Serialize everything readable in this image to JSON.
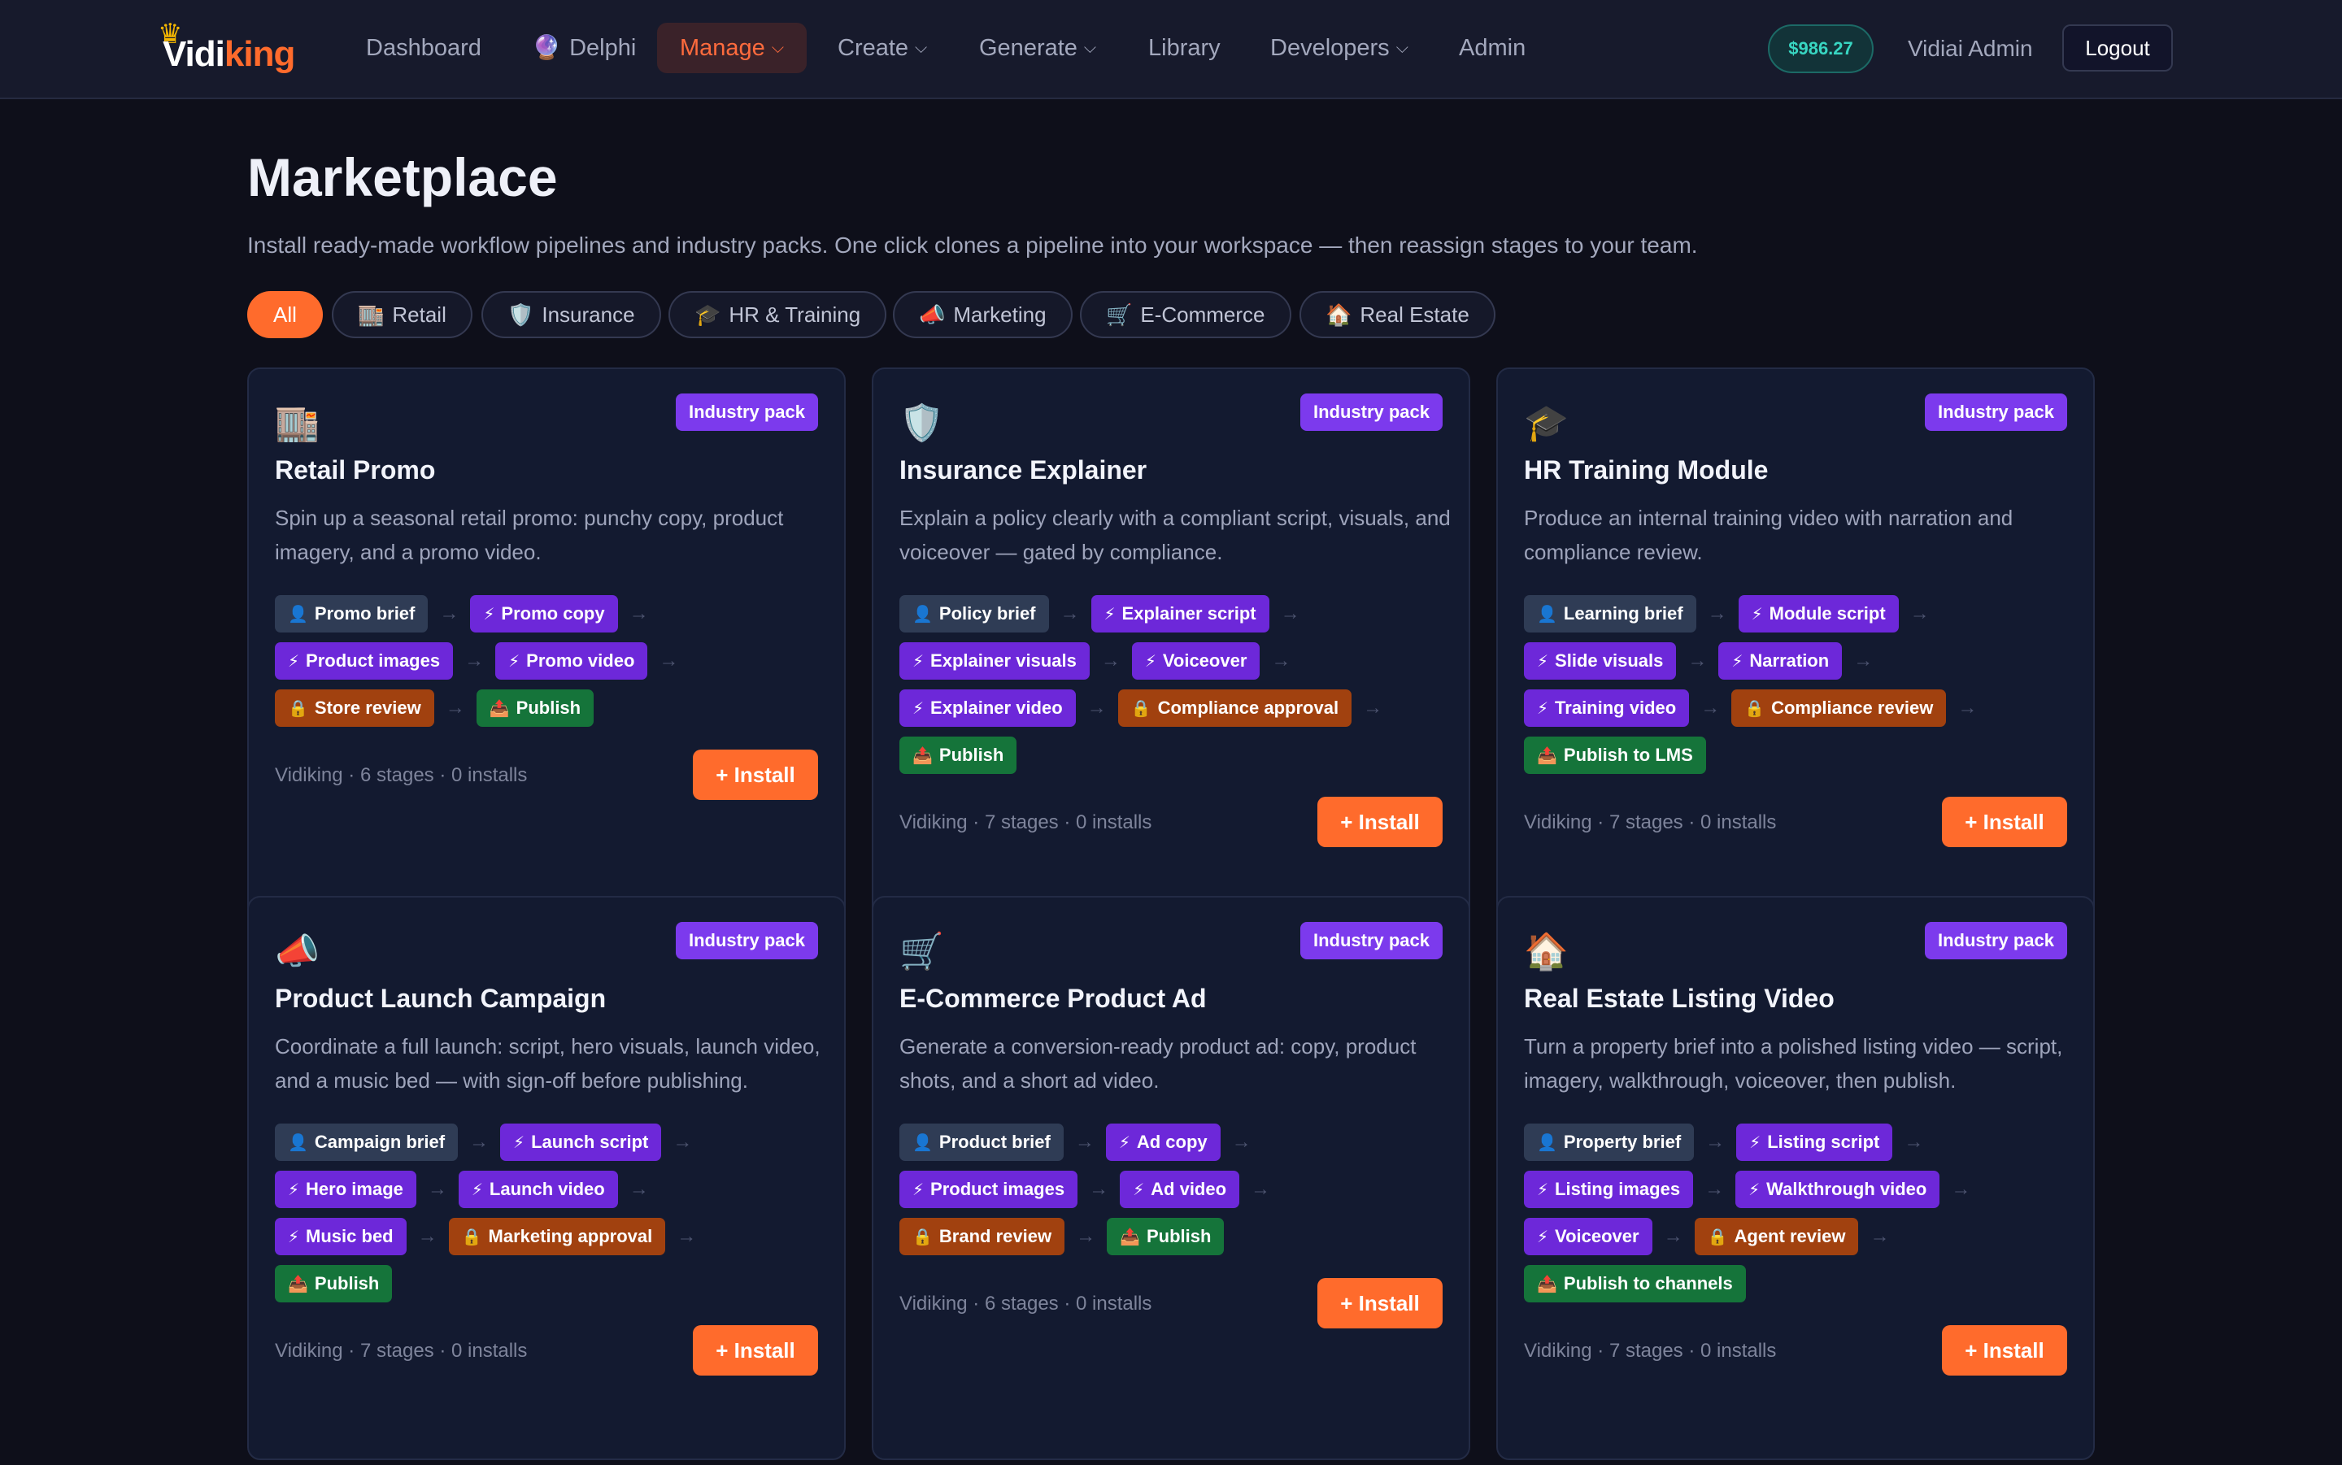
{
  "brand": {
    "part1": "Vidi",
    "part2": "king",
    "crown_icon": "crown-icon"
  },
  "nav": {
    "items": [
      {
        "label": "Dashboard",
        "dropdown": false
      },
      {
        "label": "Delphi",
        "icon": "🔮",
        "dropdown": false
      },
      {
        "label": "Manage",
        "dropdown": true,
        "active": true
      },
      {
        "label": "Create",
        "dropdown": true
      },
      {
        "label": "Generate",
        "dropdown": true
      },
      {
        "label": "Library",
        "dropdown": false
      },
      {
        "label": "Developers",
        "dropdown": true
      },
      {
        "label": "Admin",
        "dropdown": false
      }
    ],
    "balance": "$986.27",
    "user": "Vidiai Admin",
    "logout": "Logout"
  },
  "page": {
    "title": "Marketplace",
    "subtitle": "Install ready-made workflow pipelines and industry packs. One click clones a pipeline into your workspace — then reassign stages to your team."
  },
  "filters": [
    {
      "label": "All",
      "icon": "",
      "active": true
    },
    {
      "label": "Retail",
      "icon": "🏬"
    },
    {
      "label": "Insurance",
      "icon": "🛡️"
    },
    {
      "label": "HR & Training",
      "icon": "🎓"
    },
    {
      "label": "Marketing",
      "icon": "📣"
    },
    {
      "label": "E-Commerce",
      "icon": "🛒"
    },
    {
      "label": "Real Estate",
      "icon": "🏠"
    }
  ],
  "stage_icons": {
    "brief": "👤",
    "ai": "⚡",
    "review": "🔒",
    "publish": "📤"
  },
  "cards": [
    {
      "icon": "🏬",
      "badge": "Industry pack",
      "title": "Retail Promo",
      "desc": "Spin up a seasonal retail promo: punchy copy, product imagery, and a promo video.",
      "rows": [
        [
          {
            "type": "brief",
            "label": "Promo brief"
          },
          {
            "type": "ai",
            "label": "Promo copy"
          }
        ],
        [
          {
            "type": "ai",
            "label": "Product images"
          },
          {
            "type": "ai",
            "label": "Promo video"
          }
        ],
        [
          {
            "type": "review",
            "label": "Store review"
          },
          {
            "type": "publish",
            "label": "Publish"
          }
        ]
      ],
      "meta": "Vidiking · 6 stages · 0 installs",
      "install": "+ Install"
    },
    {
      "icon": "🛡️",
      "badge": "Industry pack",
      "title": "Insurance Explainer",
      "desc": "Explain a policy clearly with a compliant script, visuals, and voiceover — gated by compliance.",
      "rows": [
        [
          {
            "type": "brief",
            "label": "Policy brief"
          },
          {
            "type": "ai",
            "label": "Explainer script"
          }
        ],
        [
          {
            "type": "ai",
            "label": "Explainer visuals"
          },
          {
            "type": "ai",
            "label": "Voiceover"
          }
        ],
        [
          {
            "type": "ai",
            "label": "Explainer video"
          },
          {
            "type": "review",
            "label": "Compliance approval"
          }
        ],
        [
          {
            "type": "publish",
            "label": "Publish"
          }
        ]
      ],
      "meta": "Vidiking · 7 stages · 0 installs",
      "install": "+ Install"
    },
    {
      "icon": "🎓",
      "badge": "Industry pack",
      "title": "HR Training Module",
      "desc": "Produce an internal training video with narration and compliance review.",
      "rows": [
        [
          {
            "type": "brief",
            "label": "Learning brief"
          },
          {
            "type": "ai",
            "label": "Module script"
          }
        ],
        [
          {
            "type": "ai",
            "label": "Slide visuals"
          },
          {
            "type": "ai",
            "label": "Narration"
          }
        ],
        [
          {
            "type": "ai",
            "label": "Training video"
          },
          {
            "type": "review",
            "label": "Compliance review"
          }
        ],
        [
          {
            "type": "publish",
            "label": "Publish to LMS"
          }
        ]
      ],
      "meta": "Vidiking · 7 stages · 0 installs",
      "install": "+ Install"
    },
    {
      "icon": "📣",
      "badge": "Industry pack",
      "title": "Product Launch Campaign",
      "desc": "Coordinate a full launch: script, hero visuals, launch video, and a music bed — with sign-off before publishing.",
      "rows": [
        [
          {
            "type": "brief",
            "label": "Campaign brief"
          },
          {
            "type": "ai",
            "label": "Launch script"
          }
        ],
        [
          {
            "type": "ai",
            "label": "Hero image"
          },
          {
            "type": "ai",
            "label": "Launch video"
          }
        ],
        [
          {
            "type": "ai",
            "label": "Music bed"
          },
          {
            "type": "review",
            "label": "Marketing approval"
          }
        ],
        [
          {
            "type": "publish",
            "label": "Publish"
          }
        ]
      ],
      "meta": "Vidiking · 7 stages · 0 installs",
      "install": "+ Install"
    },
    {
      "icon": "🛒",
      "badge": "Industry pack",
      "title": "E-Commerce Product Ad",
      "desc": "Generate a conversion-ready product ad: copy, product shots, and a short ad video.",
      "rows": [
        [
          {
            "type": "brief",
            "label": "Product brief"
          },
          {
            "type": "ai",
            "label": "Ad copy"
          }
        ],
        [
          {
            "type": "ai",
            "label": "Product images"
          },
          {
            "type": "ai",
            "label": "Ad video"
          }
        ],
        [
          {
            "type": "review",
            "label": "Brand review"
          },
          {
            "type": "publish",
            "label": "Publish"
          }
        ]
      ],
      "meta": "Vidiking · 6 stages · 0 installs",
      "install": "+ Install"
    },
    {
      "icon": "🏠",
      "badge": "Industry pack",
      "title": "Real Estate Listing Video",
      "desc": "Turn a property brief into a polished listing video — script, imagery, walkthrough, voiceover, then publish.",
      "rows": [
        [
          {
            "type": "brief",
            "label": "Property brief"
          },
          {
            "type": "ai",
            "label": "Listing script"
          }
        ],
        [
          {
            "type": "ai",
            "label": "Listing images"
          },
          {
            "type": "ai",
            "label": "Walkthrough video"
          }
        ],
        [
          {
            "type": "ai",
            "label": "Voiceover"
          },
          {
            "type": "review",
            "label": "Agent review"
          }
        ],
        [
          {
            "type": "publish",
            "label": "Publish to channels"
          }
        ]
      ],
      "meta": "Vidiking · 7 stages · 0 installs",
      "install": "+ Install"
    }
  ],
  "colors": {
    "accent": "#ff6b2c",
    "badge": "#7c3aed",
    "brief": "#2f3c55",
    "ai": "#6d28d9",
    "review": "#a1410f",
    "publish": "#15743a"
  }
}
